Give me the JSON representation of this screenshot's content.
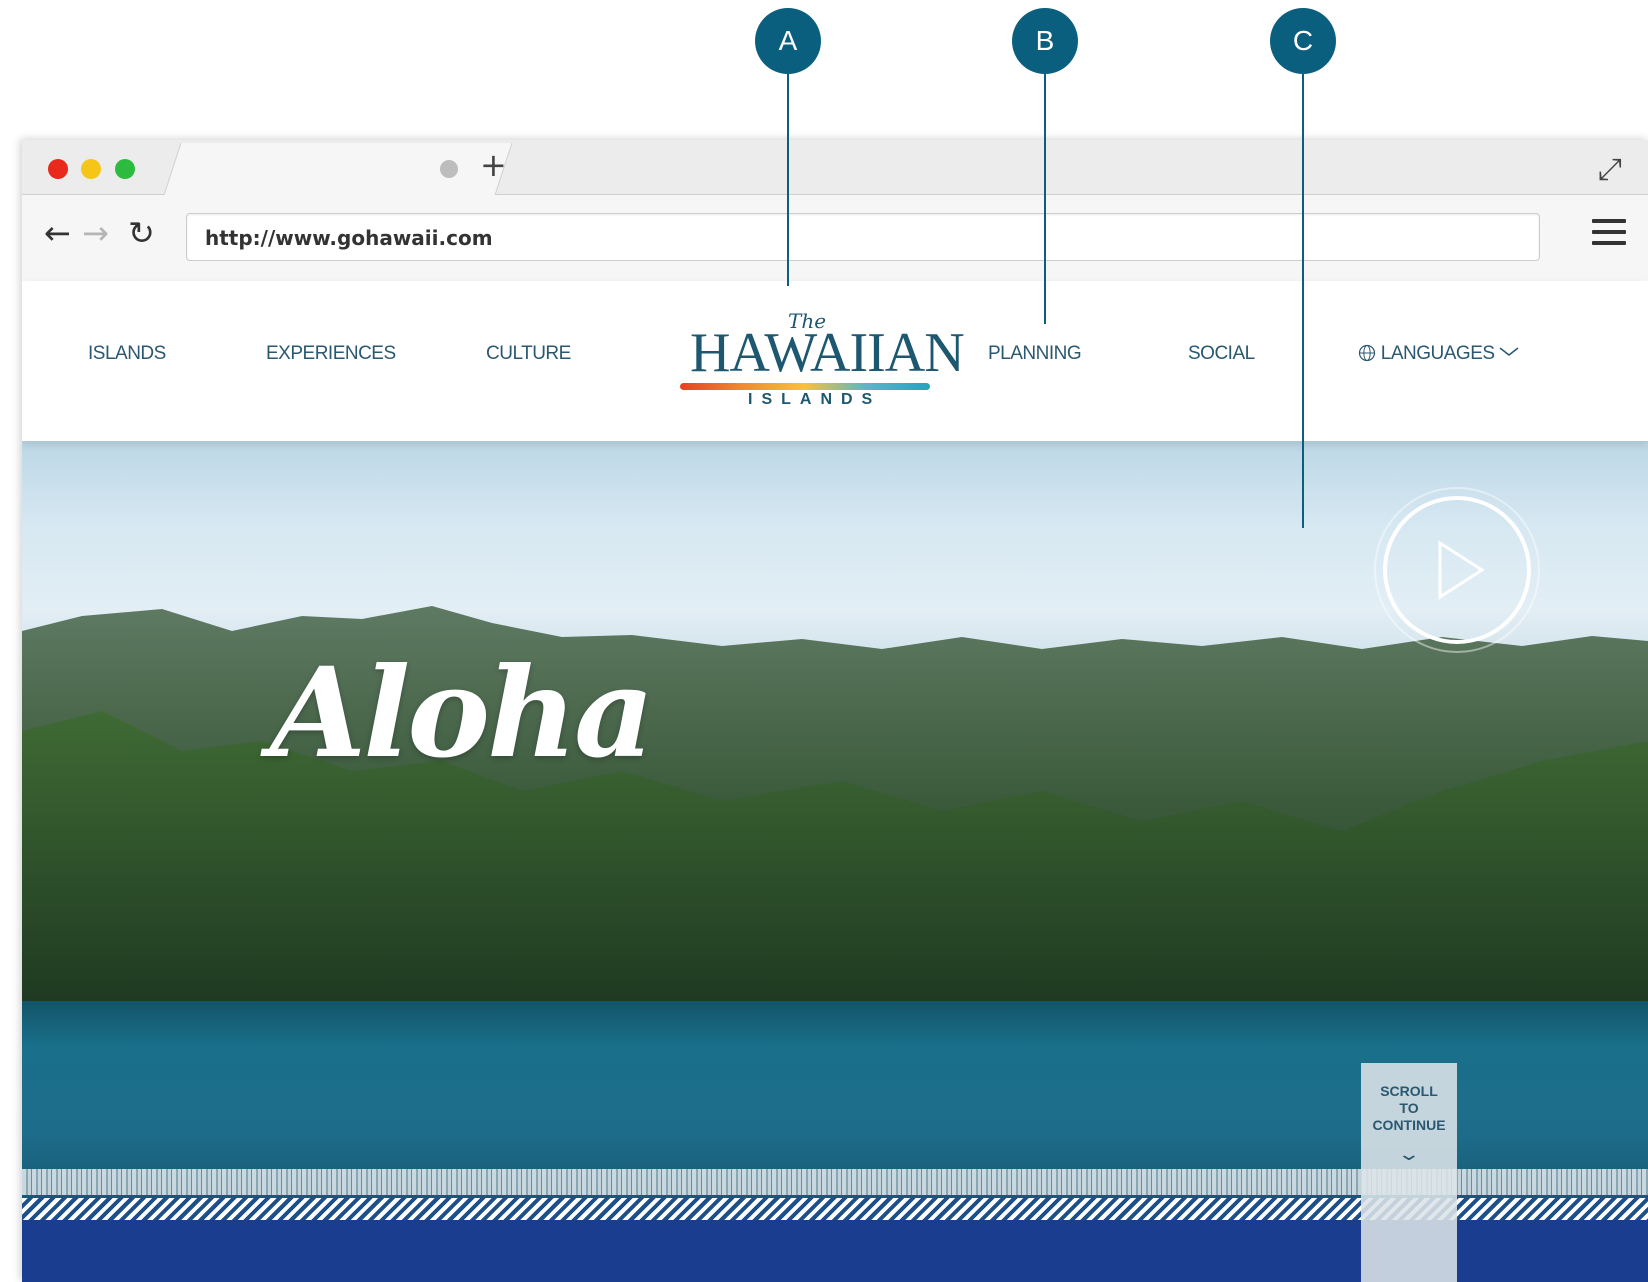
{
  "callouts": [
    "A",
    "B",
    "C"
  ],
  "browser": {
    "traffic_colors": [
      "#e8291c",
      "#f5c518",
      "#2dbb3f"
    ],
    "new_tab": "+",
    "url": "http://www.gohawaii.com",
    "icons": [
      "back-arrow-icon",
      "forward-arrow-icon",
      "reload-icon",
      "menu-icon",
      "expand-icon"
    ]
  },
  "nav": {
    "items_left": [
      "ISLANDS",
      "EXPERIENCES",
      "CULTURE"
    ],
    "items_right": [
      "PLANNING",
      "SOCIAL",
      "LANGUAGES"
    ],
    "languages_icon": "globe-icon"
  },
  "logo": {
    "the": "The",
    "main": "HAWAIIAN",
    "sub": "ISLANDS"
  },
  "hero": {
    "headline": "Aloha",
    "scroll": "SCROLL\nTO\nCONTINUE",
    "play_icon": "play-icon"
  },
  "colors": {
    "callout": "#0b5f7e",
    "nav_text": "#2b5870",
    "footer_band": "#1a3d8f"
  }
}
